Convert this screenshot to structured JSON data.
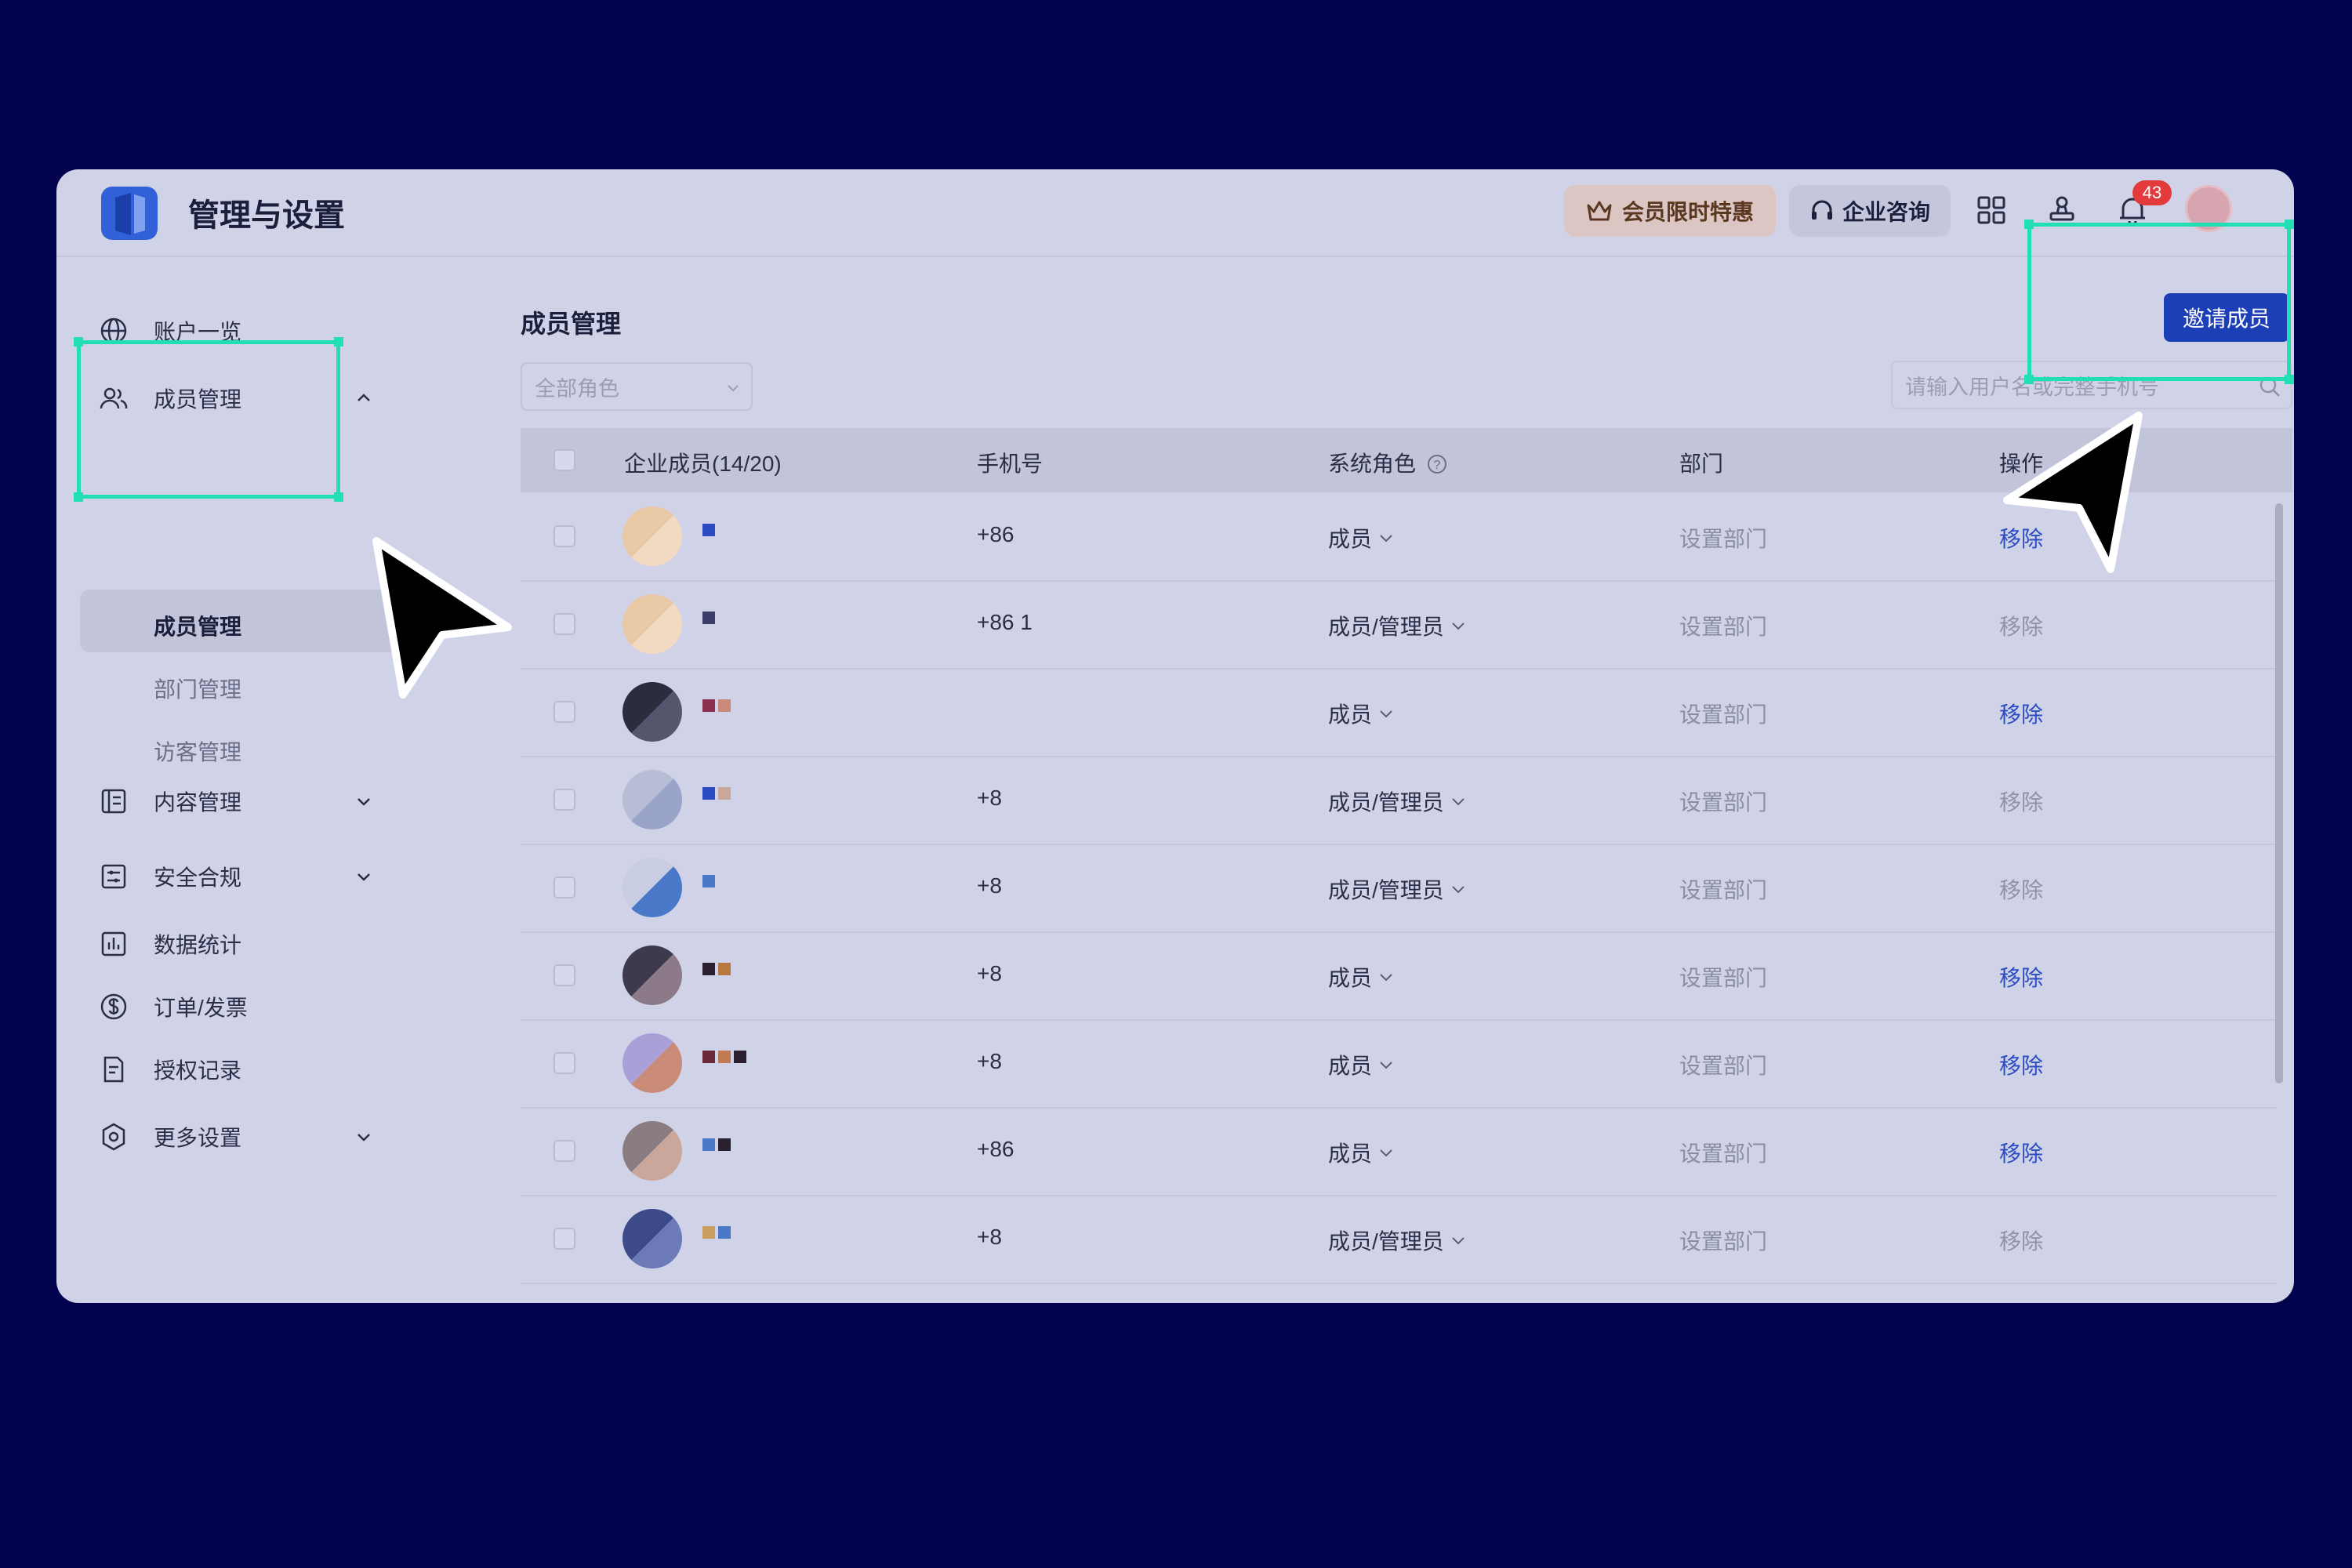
{
  "app": {
    "title": "管理与设置",
    "promo_label": "会员限时特惠",
    "consult_label": "企业咨询",
    "notification_count": "43",
    "colors": {
      "accent": "#1c3fb8",
      "highlight": "#21dfb3",
      "backdrop": "#02024f"
    }
  },
  "sidebar": {
    "items": [
      {
        "label": "账户一览",
        "icon": "globe-icon"
      },
      {
        "label": "成员管理",
        "icon": "users-icon",
        "expanded": true,
        "children": [
          "成员管理",
          "部门管理",
          "访客管理"
        ]
      },
      {
        "label": "内容管理",
        "icon": "content-icon"
      },
      {
        "label": "安全合规",
        "icon": "security-icon"
      },
      {
        "label": "数据统计",
        "icon": "chart-icon"
      },
      {
        "label": "订单/发票",
        "icon": "dollar-icon"
      },
      {
        "label": "授权记录",
        "icon": "document-icon"
      },
      {
        "label": "更多设置",
        "icon": "settings-icon"
      }
    ],
    "active_sub": "成员管理"
  },
  "main": {
    "title": "成员管理",
    "role_filter": "全部角色",
    "invite_label": "邀请成员",
    "search_placeholder": "请输入用户名或完整手机号",
    "columns": [
      "企业成员(14/20)",
      "手机号",
      "系统角色",
      "部门",
      "操作"
    ],
    "rows": [
      {
        "phone": "+86",
        "role": "成员",
        "dept": "设置部门",
        "op": "移除",
        "op_enabled": true
      },
      {
        "phone": "+86 1",
        "role": "成员/管理员",
        "dept": "设置部门",
        "op": "移除",
        "op_enabled": false
      },
      {
        "phone": "",
        "role": "成员",
        "dept": "设置部门",
        "op": "移除",
        "op_enabled": true
      },
      {
        "phone": "+8",
        "role": "成员/管理员",
        "dept": "设置部门",
        "op": "移除",
        "op_enabled": false
      },
      {
        "phone": "+8",
        "role": "成员/管理员",
        "dept": "设置部门",
        "op": "移除",
        "op_enabled": false
      },
      {
        "phone": "+8",
        "role": "成员",
        "dept": "设置部门",
        "op": "移除",
        "op_enabled": true
      },
      {
        "phone": "+8",
        "role": "成员",
        "dept": "设置部门",
        "op": "移除",
        "op_enabled": true
      },
      {
        "phone": "+86",
        "role": "成员",
        "dept": "设置部门",
        "op": "移除",
        "op_enabled": true
      },
      {
        "phone": "+8",
        "role": "成员/管理员",
        "dept": "设置部门",
        "op": "移除",
        "op_enabled": false
      }
    ]
  }
}
